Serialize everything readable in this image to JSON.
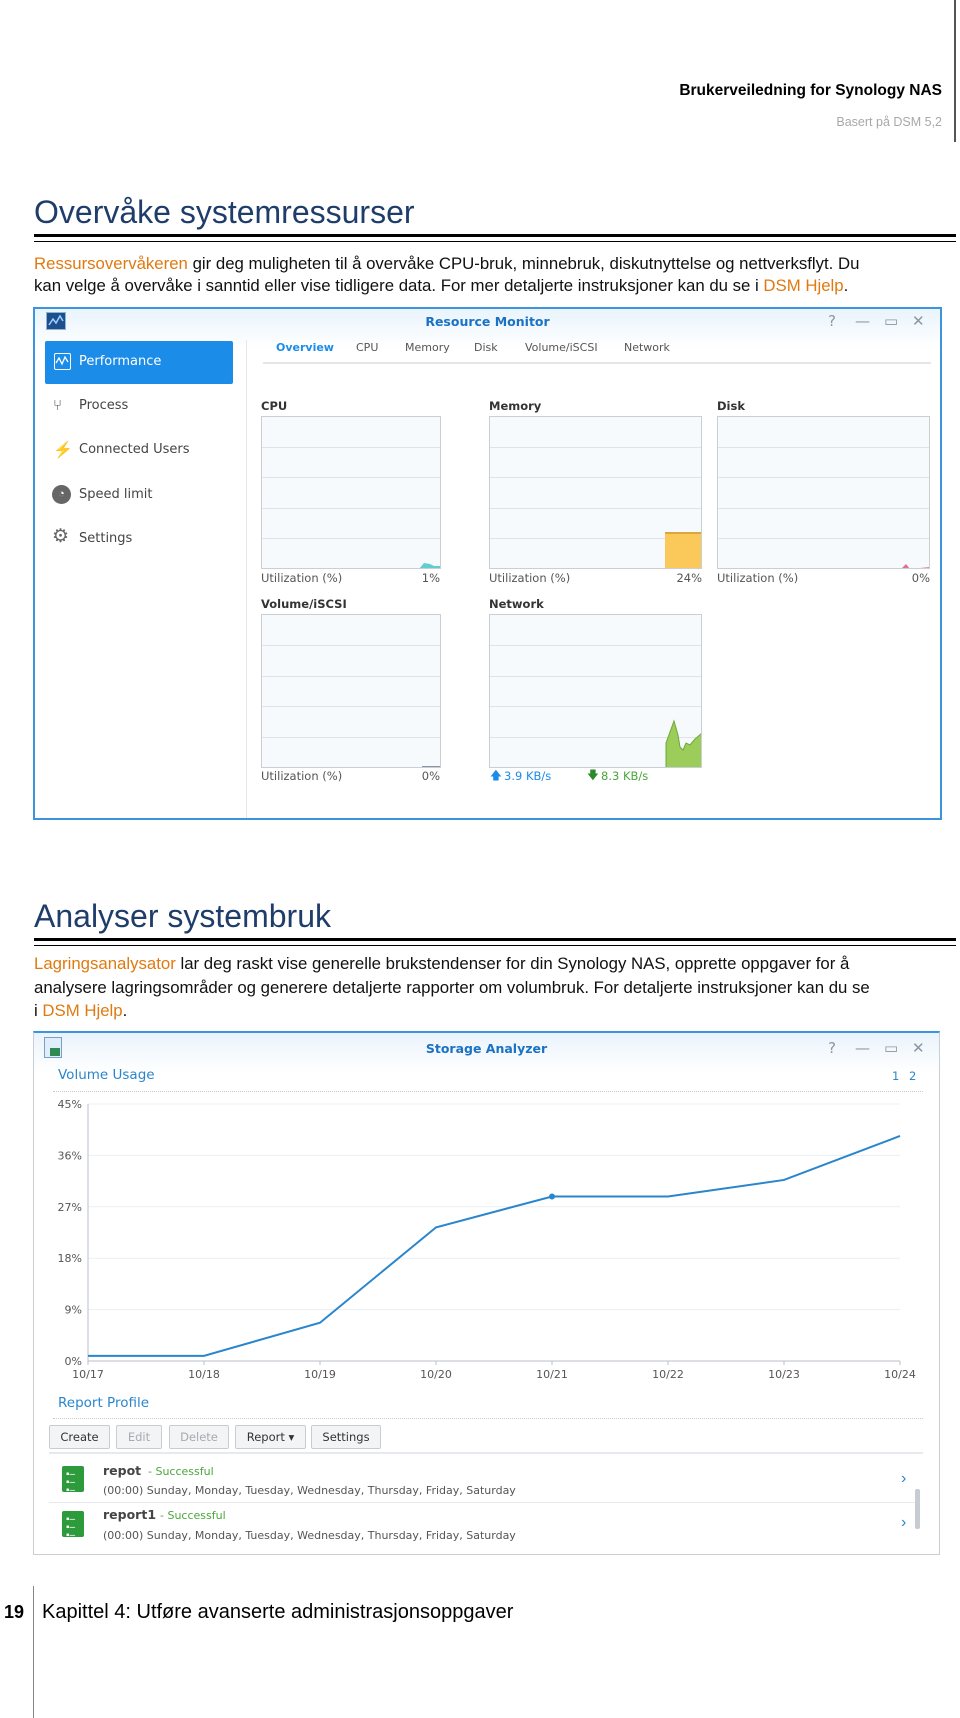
{
  "header": {
    "title": "Brukerveiledning for Synology NAS",
    "subtitle": "Basert på DSM 5,2"
  },
  "section1": {
    "heading": "Overvåke systemressurser",
    "para": {
      "highlight": "Ressursovervåkeren",
      "line1_rest": " gir deg muligheten til å overvåke CPU-bruk, minnebruk, diskutnyttelse og nettverksflyt. Du",
      "line2": "kan velge å overvåke i sanntid eller vise tidligere data. For mer detaljerte instruksjoner kan du se i ",
      "link": "DSM Hjelp",
      "end": "."
    }
  },
  "resource_monitor": {
    "title": "Resource Monitor",
    "window_controls": [
      "?",
      "—",
      "▭",
      "✕"
    ],
    "sidebar": [
      {
        "label": "Performance",
        "icon": "performance-icon",
        "active": true
      },
      {
        "label": "Process",
        "icon": "process-icon"
      },
      {
        "label": "Connected Users",
        "icon": "plug-icon"
      },
      {
        "label": "Speed limit",
        "icon": "speedometer-icon"
      },
      {
        "label": "Settings",
        "icon": "gear-icon"
      }
    ],
    "tabs": [
      "Overview",
      "CPU",
      "Memory",
      "Disk",
      "Volume/iSCSI",
      "Network"
    ],
    "active_tab": "Overview",
    "widgets": {
      "cpu": {
        "title": "CPU",
        "metric": "Utilization (%)",
        "value": "1%",
        "percent": 1,
        "color": "#5bd0cf"
      },
      "memory": {
        "title": "Memory",
        "metric": "Utilization (%)",
        "value": "24%",
        "percent": 24,
        "color": "#fbc95a"
      },
      "disk": {
        "title": "Disk",
        "metric": "Utilization (%)",
        "value": "0%",
        "percent": 0,
        "color": "#e0708e"
      },
      "volume": {
        "title": "Volume/iSCSI",
        "metric": "Utilization (%)",
        "value": "0%",
        "percent": 0
      },
      "network": {
        "title": "Network",
        "upload": "3.9 KB/s",
        "download": "8.3 KB/s",
        "upload_color": "#1b8ce8",
        "download_color": "#4aa63a",
        "area_color": "#9ccc5a"
      }
    },
    "accent": "#1b8ce8"
  },
  "section2": {
    "heading": "Analyser systembruk",
    "para": {
      "highlight": "Lagringsanalysator",
      "line1_rest": " lar deg raskt vise generelle brukstendenser for din Synology NAS, opprette oppgaver for å",
      "line2": "analysere lagringsområder og generere detaljerte rapporter om volumbruk. For detaljerte instruksjoner kan du se",
      "line3_pre": "i ",
      "link": "DSM Hjelp",
      "end": "."
    }
  },
  "storage_analyzer": {
    "title": "Storage Analyzer",
    "window_controls": [
      "?",
      "—",
      "▭",
      "✕"
    ],
    "volume_usage_label": "Volume Usage",
    "pages": [
      "1",
      "2"
    ],
    "report_profile_label": "Report Profile",
    "buttons": [
      {
        "label": "Create",
        "enabled": true
      },
      {
        "label": "Edit",
        "enabled": false
      },
      {
        "label": "Delete",
        "enabled": false
      },
      {
        "label": "Report ▾",
        "enabled": true
      },
      {
        "label": "Settings",
        "enabled": true
      }
    ],
    "reports": [
      {
        "name": "repot",
        "status": "- Successful",
        "schedule": "(00:00) Sunday, Monday, Tuesday, Wednesday, Thursday, Friday, Saturday"
      },
      {
        "name": "report1",
        "status": "- Successful",
        "schedule": "(00:00) Sunday, Monday, Tuesday, Wednesday, Thursday, Friday, Saturday"
      }
    ]
  },
  "chart_data": {
    "type": "line",
    "title": "",
    "x": [
      "10/17",
      "10/18",
      "10/19",
      "10/20",
      "10/21",
      "10/22",
      "10/23",
      "10/24"
    ],
    "values": [
      0.9,
      0.9,
      6.7,
      23.4,
      28.8,
      28.8,
      31.7,
      39.4
    ],
    "yticks": [
      "0%",
      "9%",
      "18%",
      "27%",
      "36%",
      "45%"
    ],
    "ylim": [
      0,
      45
    ],
    "grid": true,
    "highlighted_point": "10/21",
    "line_color": "#2a86cc"
  },
  "footer": {
    "page_number": "19",
    "chapter": "Kapittel 4: Utføre avanserte administrasjonsoppgaver"
  }
}
